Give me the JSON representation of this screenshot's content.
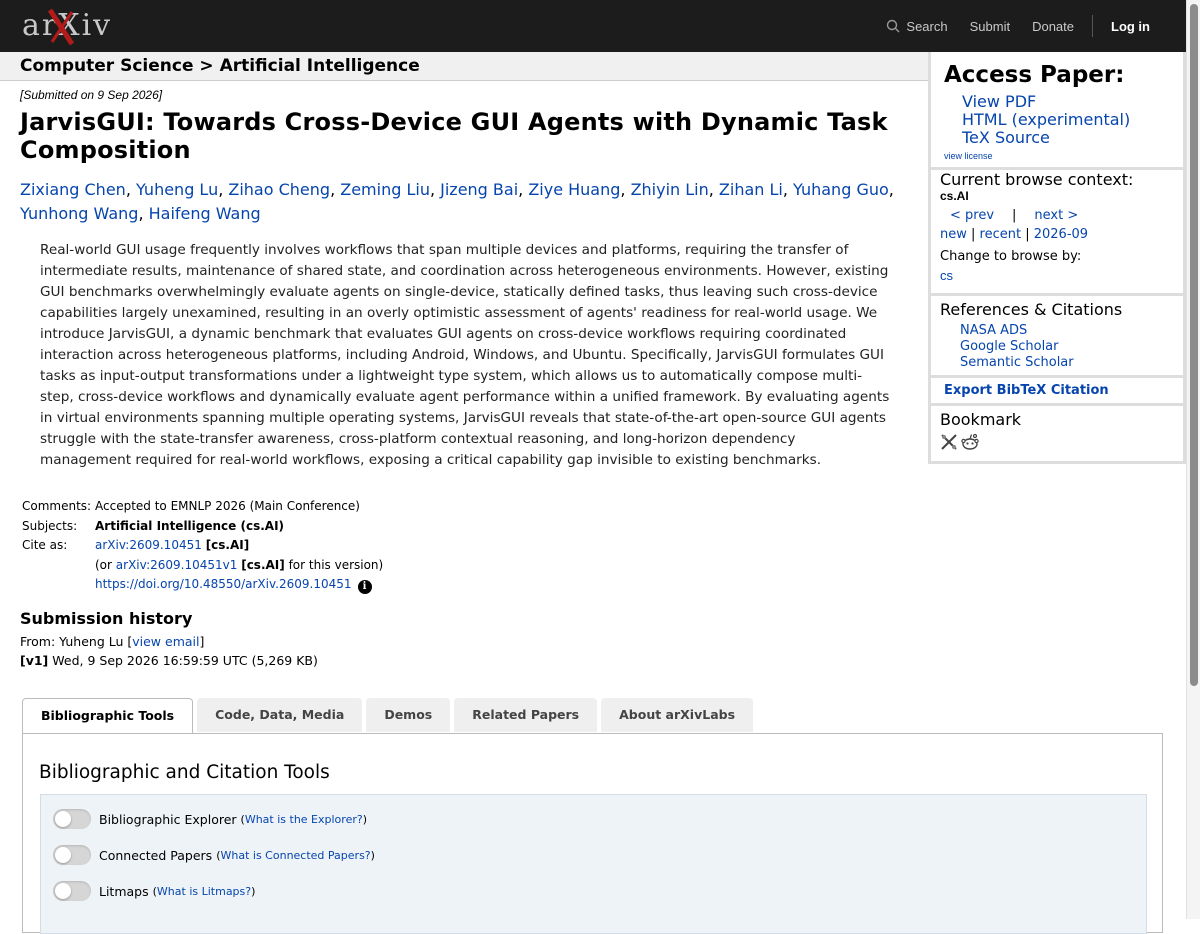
{
  "header": {
    "logo_text": "arXiv",
    "search_label": "Search",
    "submit_label": "Submit",
    "donate_label": "Donate",
    "login_label": "Log in"
  },
  "breadcrumb": "Computer Science > Artificial Intelligence",
  "paper": {
    "submitted": "[Submitted on 9 Sep 2026]",
    "title": "JarvisGUI: Towards Cross-Device GUI Agents with Dynamic Task Composition",
    "authors": [
      "Zixiang Chen",
      "Yuheng Lu",
      "Zihao Cheng",
      "Zeming Liu",
      "Jizeng Bai",
      "Ziye Huang",
      "Zhiyin Lin",
      "Zihan Li",
      "Yuhang Guo",
      "Yunhong Wang",
      "Haifeng Wang"
    ],
    "abstract": "Real-world GUI usage frequently involves workflows that span multiple devices and platforms, requiring the transfer of intermediate results, maintenance of shared state, and coordination across heterogeneous environments. However, existing GUI benchmarks overwhelmingly evaluate agents on single-device, statically defined tasks, thus leaving such cross-device capabilities largely unexamined, resulting in an overly optimistic assessment of agents' readiness for real-world usage. We introduce JarvisGUI, a dynamic benchmark that evaluates GUI agents on cross-device workflows requiring coordinated interaction across heterogeneous platforms, including Android, Windows, and Ubuntu. Specifically, JarvisGUI formulates GUI tasks as input-output transformations under a lightweight type system, which allows us to automatically compose multi-step, cross-device workflows and dynamically evaluate agent performance within a unified framework. By evaluating agents in virtual environments spanning multiple operating systems, JarvisGUI reveals that state-of-the-art open-source GUI agents struggle with the state-transfer awareness, cross-platform contextual reasoning, and long-horizon dependency management required for real-world workflows, exposing a critical capability gap invisible to existing benchmarks."
  },
  "meta": {
    "comments_label": "Comments:",
    "comments": "Accepted to EMNLP 2026 (Main Conference)",
    "subjects_label": "Subjects:",
    "subjects": "Artificial Intelligence (cs.AI)",
    "cite_label": "Cite as:",
    "cite_id": "arXiv:2609.10451",
    "cite_cat": "[cs.AI]",
    "cite_or_prefix": "(or ",
    "cite_version_id": "arXiv:2609.10451v1",
    "cite_version_cat": "[cs.AI]",
    "cite_version_suffix": " for this version)",
    "doi": "https://doi.org/10.48550/arXiv.2609.10451",
    "info_glyph": "i"
  },
  "history": {
    "heading": "Submission history",
    "from_prefix": "From: Yuheng Lu [",
    "view_email": "view email",
    "from_suffix": "]",
    "version": "[v1]",
    "version_detail": " Wed, 9 Sep 2026 16:59:59 UTC (5,269 KB)"
  },
  "tabs": [
    "Bibliographic Tools",
    "Code, Data, Media",
    "Demos",
    "Related Papers",
    "About arXivLabs"
  ],
  "panel": {
    "heading": "Bibliographic and Citation Tools",
    "tools": [
      {
        "label": "Bibliographic Explorer",
        "hint": "What is the Explorer?"
      },
      {
        "label": "Connected Papers",
        "hint": "What is Connected Papers?"
      },
      {
        "label": "Litmaps",
        "hint": "What is Litmaps?"
      }
    ]
  },
  "sidebar": {
    "access_heading": "Access Paper:",
    "view_pdf": "View PDF",
    "html": "HTML (experimental)",
    "tex": "TeX Source",
    "view_license": "view license",
    "context_heading": "Current browse context:",
    "context_cat": "cs.AI",
    "prev": "< prev",
    "pipe": "|",
    "next": "next >",
    "new": "new",
    "recent": "recent",
    "month": "2026-09",
    "change_label": "Change to browse by:",
    "cs": "cs",
    "refs_heading": "References & Citations",
    "nasa": "NASA ADS",
    "google": "Google Scholar",
    "semantic": "Semantic Scholar",
    "export": "Export BibTeX Citation",
    "bookmark_heading": "Bookmark"
  }
}
